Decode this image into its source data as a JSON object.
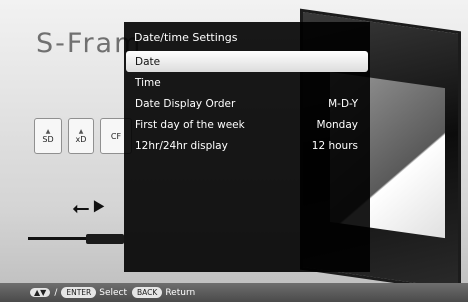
{
  "background": {
    "logo": "S-Fram",
    "cards": [
      "SD",
      "xD",
      "CF"
    ],
    "usb_icon": "usb-icon"
  },
  "menu": {
    "title": "Date/time Settings",
    "items": [
      {
        "label": "Date",
        "value": ""
      },
      {
        "label": "Time",
        "value": ""
      },
      {
        "label": "Date Display Order",
        "value": "M-D-Y"
      },
      {
        "label": "First day of the week",
        "value": "Monday"
      },
      {
        "label": "12hr/24hr display",
        "value": "12 hours"
      }
    ],
    "selected_index": 0
  },
  "footer": {
    "arrows_icon": "up-down-arrows-icon",
    "slash": "/",
    "enter_key": "ENTER",
    "select_label": "Select",
    "back_key": "BACK",
    "return_label": "Return"
  }
}
